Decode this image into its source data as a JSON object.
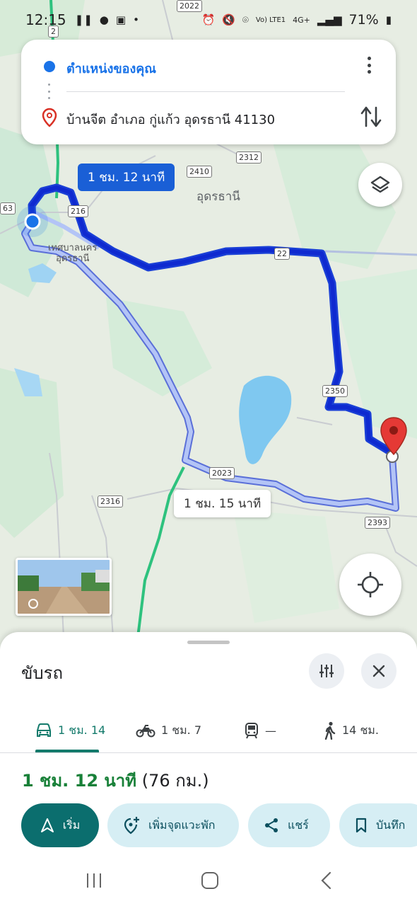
{
  "status_bar": {
    "time": "12:15",
    "network": "Vo) LTE1",
    "signal": "4G+",
    "battery": "71%"
  },
  "directions": {
    "origin": "ตำแหน่งของคุณ",
    "destination": "บ้านจีต อำเภอ กู่แก้ว อุดรธานี 41130"
  },
  "map": {
    "city_label": "อุดรธานี",
    "municipality_label_line1": "เทศบาลนคร",
    "municipality_label_line2": "อุดรธานี",
    "route_primary_label": "1 ชม. 12 นาที",
    "route_alt_label": "1 ชม. 15 นาที",
    "shields": [
      "2022",
      "2",
      "2312",
      "2410",
      "216",
      "22",
      "2350",
      "2023",
      "2316",
      "2393",
      "63"
    ],
    "colors": {
      "route_primary": "#1a3fd6",
      "route_alt": "#a9b9f2",
      "destination_pin": "#d93025",
      "origin_dot": "#1a73e8"
    }
  },
  "sheet": {
    "title": "ขับรถ",
    "modes": [
      {
        "icon": "car-icon",
        "label": "1 ชม. 14",
        "active": true
      },
      {
        "icon": "motorcycle-icon",
        "label": "1 ชม. 7",
        "active": false
      },
      {
        "icon": "train-icon",
        "label": "—",
        "active": false
      },
      {
        "icon": "walk-icon",
        "label": "14 ชม.",
        "active": false
      }
    ],
    "summary_duration": "1 ชม. 12 นาที",
    "summary_distance": "(76 กม.)",
    "actions": {
      "start": "เริ่ม",
      "add_stop": "เพิ่มจุดแวะพัก",
      "share": "แชร์",
      "save": "บันทึก"
    },
    "accent_color": "#137a6b"
  }
}
